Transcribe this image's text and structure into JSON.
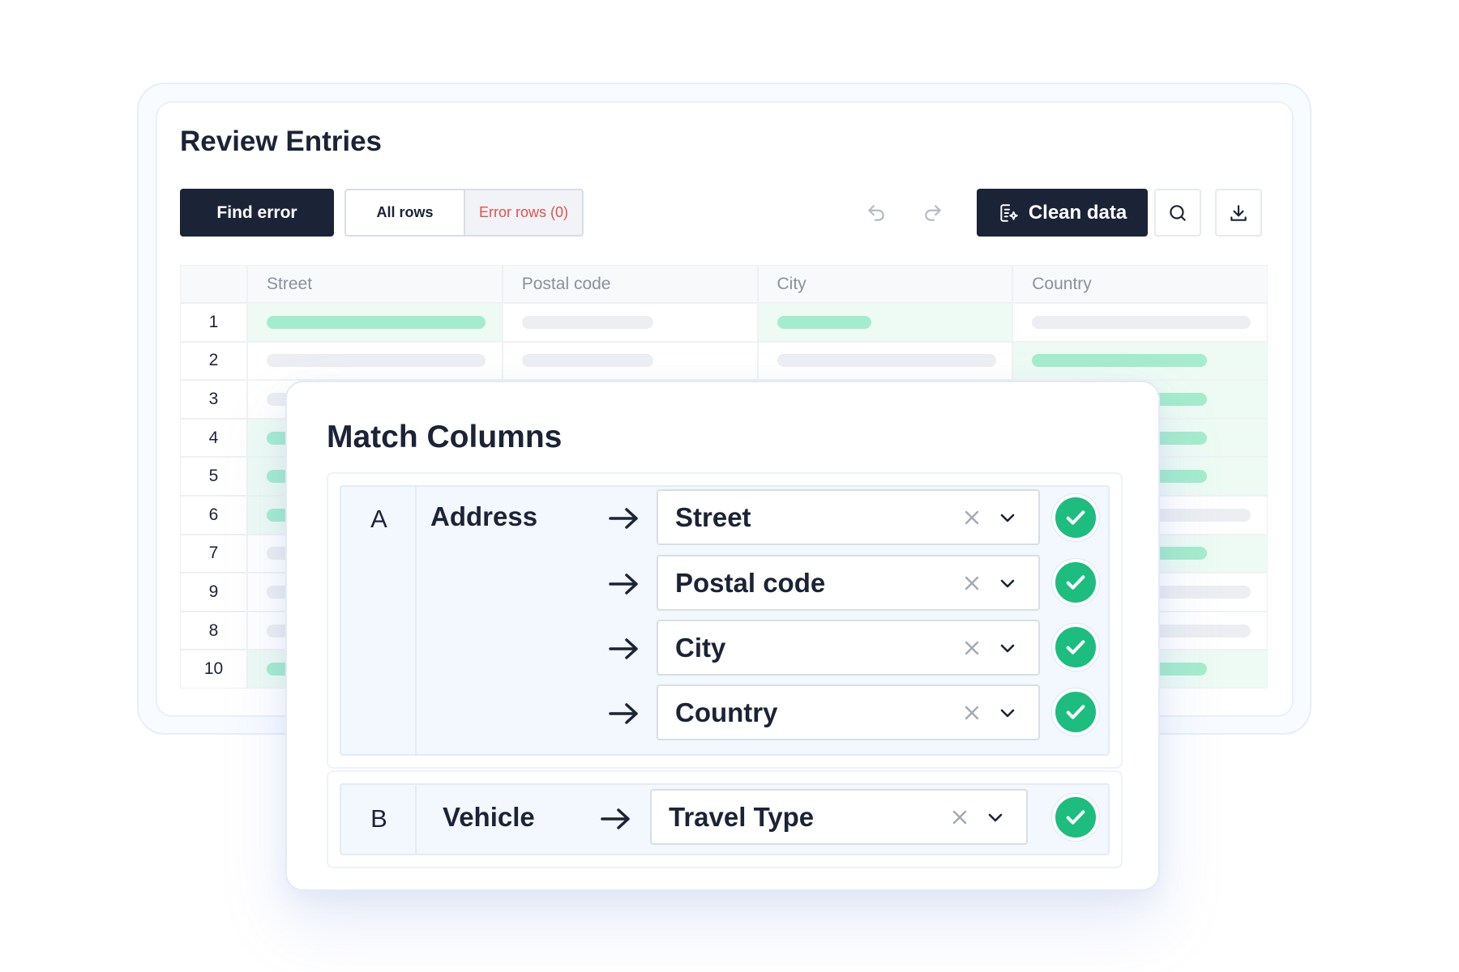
{
  "review": {
    "title": "Review Entries",
    "find_error_label": "Find error",
    "all_rows_label": "All rows",
    "error_rows_label": "Error rows (0)",
    "clean_data_label": "Clean data",
    "columns": [
      "Street",
      "Postal code",
      "City",
      "Country"
    ],
    "rows": [
      {
        "index": "1"
      },
      {
        "index": "2"
      },
      {
        "index": "3"
      },
      {
        "index": "4"
      },
      {
        "index": "5"
      },
      {
        "index": "6"
      },
      {
        "index": "7"
      },
      {
        "index": "9"
      },
      {
        "index": "8"
      },
      {
        "index": "10"
      }
    ]
  },
  "match": {
    "title": "Match Columns",
    "group_a": {
      "letter": "A",
      "source": "Address",
      "targets": [
        "Street",
        "Postal code",
        "City",
        "Country"
      ]
    },
    "group_b": {
      "letter": "B",
      "source": "Vehicle",
      "target": "Travel Type"
    }
  },
  "colors": {
    "dark": "#1b2336",
    "accent_green": "#1cbd7f",
    "pill_green": "#a5ecce",
    "error_red": "#e05151"
  }
}
